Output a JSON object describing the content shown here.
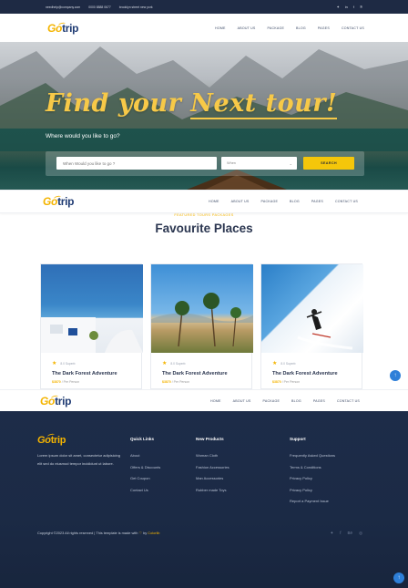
{
  "topbar": {
    "email": "needhelp@company.com",
    "phone": "0000 8888 0677",
    "address": "brooklyn street new york",
    "social": [
      "twitter-icon",
      "linkedin-icon",
      "facebook-icon",
      "pinterest-icon"
    ]
  },
  "logo": {
    "go": "Go",
    "trip": "trip"
  },
  "menu": [
    "HOME",
    "ABOUT US",
    "PACKAGE",
    "BLOG",
    "PAGES",
    "CONTACT US"
  ],
  "hero": {
    "title_a": "Find your ",
    "title_b": "Next tour!",
    "subtitle": "Where would you like to go?",
    "search_placeholder": "When Would you like to go ?",
    "when_label": "When",
    "search_button": "SEARCH"
  },
  "places": {
    "kicker": "FEATURED TOURS PACKAGES",
    "title": "Favourite Places",
    "cards": [
      {
        "rating": "8.0 Superb",
        "name": "The Dark Forest Adventure",
        "price": "$3870",
        "per": " / Per Person"
      },
      {
        "rating": "8.0 Superb",
        "name": "The Dark Forest Adventure",
        "price": "$3870",
        "per": " / Per Person"
      },
      {
        "rating": "8.0 Superb",
        "name": "The Dark Forest Adventure",
        "price": "$3870",
        "per": " / Per Person"
      }
    ]
  },
  "footer": {
    "about": "Lorem ipsum dolor sit amet, consectetur adipisicing elit sed do eiusmod tempor incididunt ut labore.",
    "quick_links": {
      "title": "Quick Links",
      "items": [
        "About",
        "Offers & Discounts",
        "Get Coupon",
        "Contact Us"
      ]
    },
    "new_products": {
      "title": "New Products",
      "items": [
        "Woman Cloth",
        "Fashion Accessories",
        "Man Accessories",
        "Rubber made Toys"
      ]
    },
    "support": {
      "title": "Support",
      "items": [
        "Frequently Asked Questions",
        "Terms & Conditions",
        "Privacy Policy",
        "Privacy Policy",
        "Report a Payment Issue"
      ]
    },
    "copyright_a": "Copyright ©2023 All rights reserved | This template is made with ",
    "copyright_b": " by ",
    "brand": "Colorlib",
    "social": [
      "twitter-icon",
      "facebook-icon",
      "behance-icon",
      "globe-icon"
    ]
  },
  "colors": {
    "accent": "#f4b400",
    "navy": "#1d2c49",
    "to_top": "#2e7fd8"
  }
}
